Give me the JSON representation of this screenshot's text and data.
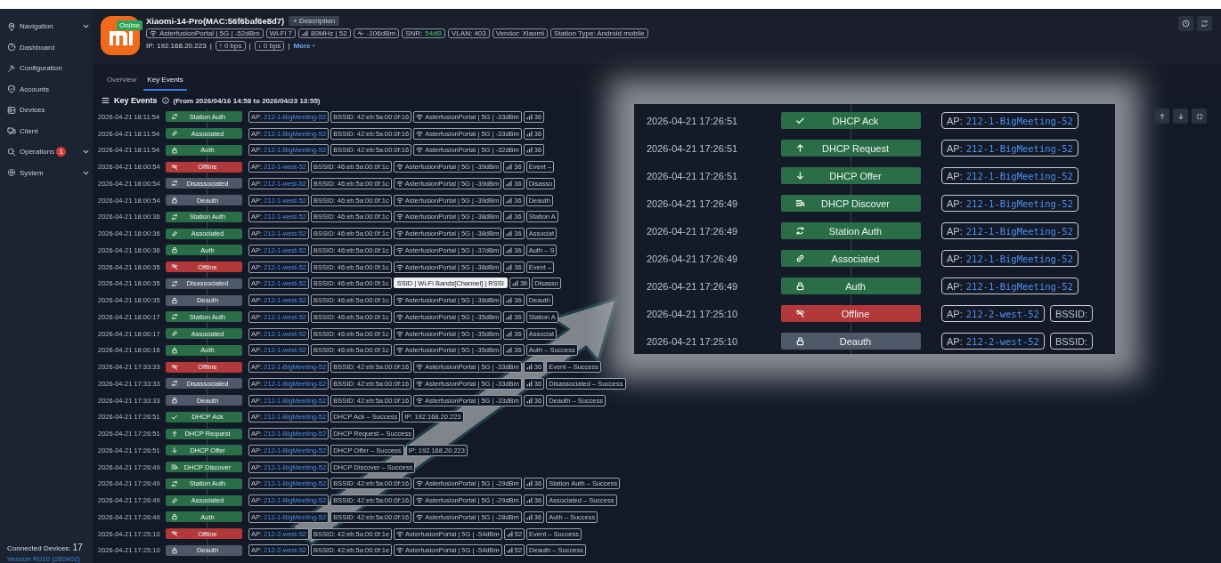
{
  "sidebar": {
    "items": [
      {
        "label": "Navigation",
        "expandable": true
      },
      {
        "label": "Dashboard",
        "expandable": false
      },
      {
        "label": "Configuration",
        "expandable": false
      },
      {
        "label": "Accounts",
        "expandable": false
      },
      {
        "label": "Devices",
        "expandable": false
      },
      {
        "label": "Client",
        "expandable": false
      },
      {
        "label": "Operations",
        "expandable": true,
        "badge": "1"
      },
      {
        "label": "System",
        "expandable": true
      }
    ],
    "connected_label": "Connected Devices:",
    "connected_count": "17",
    "version": "Version R010 (260402)"
  },
  "client": {
    "name": "Xiaomi-14-Pro(MAC:56f6baf6e8d7)",
    "status": "Online",
    "description_button": "+ Description",
    "tags": [
      {
        "kind": "wifi",
        "text": "AsterfusionPortal | 5G | -52dBm"
      },
      {
        "kind": "text",
        "text": "Wi-Fi 7"
      },
      {
        "kind": "bars",
        "text": "80MHz | 52"
      },
      {
        "kind": "noise",
        "text": "-106dBm"
      },
      {
        "kind": "snr",
        "label": "SNR:",
        "value": "54dB"
      },
      {
        "kind": "text",
        "text": "VLAN: 403"
      },
      {
        "kind": "text",
        "text": "Vendor: Xiaomi"
      },
      {
        "kind": "text",
        "text": "Station Type: Android mobile"
      }
    ],
    "ip": "IP: 192.168.20.223",
    "separator": "|",
    "upload": "↑ 0 bps",
    "download": "↓ 0 bps",
    "more": "More ›"
  },
  "tabs": [
    {
      "label": "Overview",
      "selected": false
    },
    {
      "label": "Key Events",
      "selected": true
    }
  ],
  "events": {
    "title": "Key Events",
    "range": "(From 2026/04/16 14:58 to 2026/04/23 13:55)",
    "rows": [
      {
        "time": "2026-04-21 18:11:54",
        "event": {
          "label": "Station Auth",
          "kind": "station-auth"
        },
        "tags": [
          {
            "kind": "ap",
            "label": "AP:",
            "value": "212-1-BigMeeting-52"
          },
          {
            "kind": "text",
            "text": "BSSID: 42:eb:5a:00:0f:16"
          },
          {
            "kind": "ssid",
            "text": "AsterfusionPortal | 5G | -33dBm"
          },
          {
            "kind": "channel",
            "text": "36"
          }
        ]
      },
      {
        "time": "2026-04-21 18:11:54",
        "event": {
          "label": "Associated",
          "kind": "associated"
        },
        "tags": [
          {
            "kind": "ap",
            "label": "AP:",
            "value": "212-1-BigMeeting-52"
          },
          {
            "kind": "text",
            "text": "BSSID: 42:eb:5a:00:0f:16"
          },
          {
            "kind": "ssid",
            "text": "AsterfusionPortal | 5G | -33dBm"
          },
          {
            "kind": "channel",
            "text": "36"
          }
        ]
      },
      {
        "time": "2026-04-21 18:11:54",
        "event": {
          "label": "Auth",
          "kind": "auth"
        },
        "tags": [
          {
            "kind": "ap",
            "label": "AP:",
            "value": "212-1-BigMeeting-52"
          },
          {
            "kind": "text",
            "text": "BSSID: 42:eb:5a:00:0f:16"
          },
          {
            "kind": "ssid",
            "text": "AsterfusionPortal | 5G | -32dBm"
          },
          {
            "kind": "channel",
            "text": "36"
          }
        ]
      },
      {
        "time": "2026-04-21 18:00:54",
        "event": {
          "label": "Offline",
          "kind": "offline"
        },
        "tags": [
          {
            "kind": "ap",
            "label": "AP:",
            "value": "212-1-west-52"
          },
          {
            "kind": "text",
            "text": "BSSID: 46:eb:5a:00:0f:1c"
          },
          {
            "kind": "ssid",
            "text": "AsterfusionPortal | 5G | -39dBm"
          },
          {
            "kind": "channel",
            "text": "36"
          },
          {
            "kind": "text",
            "text": "Event –"
          }
        ]
      },
      {
        "time": "2026-04-21 18:00:54",
        "event": {
          "label": "Disassociated",
          "kind": "disassociated"
        },
        "tags": [
          {
            "kind": "ap",
            "label": "AP:",
            "value": "212-1-west-52"
          },
          {
            "kind": "text",
            "text": "BSSID: 46:eb:5a:00:0f:1c"
          },
          {
            "kind": "ssid",
            "text": "AsterfusionPortal | 5G | -39dBm"
          },
          {
            "kind": "channel",
            "text": "36"
          },
          {
            "kind": "text",
            "text": "Disasso"
          }
        ]
      },
      {
        "time": "2026-04-21 18:00:54",
        "event": {
          "label": "Deauth",
          "kind": "deauth"
        },
        "tags": [
          {
            "kind": "ap",
            "label": "AP:",
            "value": "212-1-west-52"
          },
          {
            "kind": "text",
            "text": "BSSID: 46:eb:5a:00:0f:1c"
          },
          {
            "kind": "ssid",
            "text": "AsterfusionPortal | 5G | -39dBm"
          },
          {
            "kind": "channel",
            "text": "36"
          },
          {
            "kind": "text",
            "text": "Deauth"
          }
        ]
      },
      {
        "time": "2026-04-21 18:00:36",
        "event": {
          "label": "Station Auth",
          "kind": "station-auth"
        },
        "tags": [
          {
            "kind": "ap",
            "label": "AP:",
            "value": "212-1-west-52"
          },
          {
            "kind": "text",
            "text": "BSSID: 46:eb:5a:00:0f:1c"
          },
          {
            "kind": "ssid",
            "text": "AsterfusionPortal | 5G | -38dBm"
          },
          {
            "kind": "channel",
            "text": "36"
          },
          {
            "kind": "text",
            "text": "Station A"
          }
        ]
      },
      {
        "time": "2026-04-21 18:00:36",
        "event": {
          "label": "Associated",
          "kind": "associated"
        },
        "tags": [
          {
            "kind": "ap",
            "label": "AP:",
            "value": "212-1-west-52"
          },
          {
            "kind": "text",
            "text": "BSSID: 46:eb:5a:00:0f:1c"
          },
          {
            "kind": "ssid",
            "text": "AsterfusionPortal | 5G | -38dBm"
          },
          {
            "kind": "channel",
            "text": "36"
          },
          {
            "kind": "text",
            "text": "Associat"
          }
        ]
      },
      {
        "time": "2026-04-21 18:00:36",
        "event": {
          "label": "Auth",
          "kind": "auth"
        },
        "tags": [
          {
            "kind": "ap",
            "label": "AP:",
            "value": "212-1-west-52"
          },
          {
            "kind": "text",
            "text": "BSSID: 46:eb:5a:00:0f:1c"
          },
          {
            "kind": "ssid",
            "text": "AsterfusionPortal | 5G | -37dBm"
          },
          {
            "kind": "channel",
            "text": "36"
          },
          {
            "kind": "text",
            "text": "Auth – S"
          }
        ]
      },
      {
        "time": "2026-04-21 18:00:35",
        "event": {
          "label": "Offline",
          "kind": "offline"
        },
        "tags": [
          {
            "kind": "ap",
            "label": "AP:",
            "value": "212-1-west-52"
          },
          {
            "kind": "text",
            "text": "BSSID: 46:eb:5a:00:0f:1c"
          },
          {
            "kind": "ssid",
            "text": "AsterfusionPortal | 5G | -38dBm"
          },
          {
            "kind": "channel",
            "text": "36"
          },
          {
            "kind": "text",
            "text": "Event –"
          }
        ]
      },
      {
        "time": "2026-04-21 18:00:35",
        "event": {
          "label": "Disassociated",
          "kind": "disassociated"
        },
        "tags": [
          {
            "kind": "ap",
            "label": "AP:",
            "value": "212-1-west-52"
          },
          {
            "kind": "text",
            "text": "BSSID: 46:eb:5a:00:0f:1c"
          },
          {
            "kind": "tooltip",
            "text": "SSID | Wi-Fi Bands[Channel] | RSSI"
          },
          {
            "kind": "channel",
            "text": "36"
          },
          {
            "kind": "text",
            "text": "Disasso"
          }
        ]
      },
      {
        "time": "2026-04-21 18:00:35",
        "event": {
          "label": "Deauth",
          "kind": "deauth"
        },
        "tags": [
          {
            "kind": "ap",
            "label": "AP:",
            "value": "212-1-west-52"
          },
          {
            "kind": "text",
            "text": "BSSID: 46:eb:5a:00:0f:1c"
          },
          {
            "kind": "ssid",
            "text": "AsterfusionPortal | 5G | -38dBm"
          },
          {
            "kind": "channel",
            "text": "36"
          },
          {
            "kind": "text",
            "text": "Deauth"
          }
        ]
      },
      {
        "time": "2026-04-21 18:00:17",
        "event": {
          "label": "Station Auth",
          "kind": "station-auth"
        },
        "tags": [
          {
            "kind": "ap",
            "label": "AP:",
            "value": "212-1-west-52"
          },
          {
            "kind": "text",
            "text": "BSSID: 46:eb:5a:00:0f:1c"
          },
          {
            "kind": "ssid",
            "text": "AsterfusionPortal | 5G | -35dBm"
          },
          {
            "kind": "channel",
            "text": "36"
          },
          {
            "kind": "text",
            "text": "Station A"
          }
        ]
      },
      {
        "time": "2026-04-21 18:00:17",
        "event": {
          "label": "Associated",
          "kind": "associated"
        },
        "tags": [
          {
            "kind": "ap",
            "label": "AP:",
            "value": "212-1-west-52"
          },
          {
            "kind": "text",
            "text": "BSSID: 46:eb:5a:00:0f:1c"
          },
          {
            "kind": "ssid",
            "text": "AsterfusionPortal | 5G | -35dBm"
          },
          {
            "kind": "channel",
            "text": "36"
          },
          {
            "kind": "text",
            "text": "Associat"
          }
        ]
      },
      {
        "time": "2026-04-21 18:00:16",
        "event": {
          "label": "Auth",
          "kind": "auth"
        },
        "tags": [
          {
            "kind": "ap",
            "label": "AP:",
            "value": "212-1-west-52"
          },
          {
            "kind": "text",
            "text": "BSSID: 46:eb:5a:00:0f:1c"
          },
          {
            "kind": "ssid",
            "text": "AsterfusionPortal | 5G | -35dBm"
          },
          {
            "kind": "channel",
            "text": "36"
          },
          {
            "kind": "text",
            "text": "Auth – Success"
          }
        ]
      },
      {
        "time": "2026-04-21 17:33:33",
        "event": {
          "label": "Offline",
          "kind": "offline"
        },
        "tags": [
          {
            "kind": "ap",
            "label": "AP:",
            "value": "212-1-BigMeeting-52"
          },
          {
            "kind": "text",
            "text": "BSSID: 42:eb:5a:00:0f:16"
          },
          {
            "kind": "ssid",
            "text": "AsterfusionPortal | 5G | -33dBm"
          },
          {
            "kind": "channel",
            "text": "36"
          },
          {
            "kind": "text",
            "text": "Event – Success"
          }
        ]
      },
      {
        "time": "2026-04-21 17:33:33",
        "event": {
          "label": "Disassociated",
          "kind": "disassociated"
        },
        "tags": [
          {
            "kind": "ap",
            "label": "AP:",
            "value": "212-1-BigMeeting-52"
          },
          {
            "kind": "text",
            "text": "BSSID: 42:eb:5a:00:0f:16"
          },
          {
            "kind": "ssid",
            "text": "AsterfusionPortal | 5G | -33dBm"
          },
          {
            "kind": "channel",
            "text": "36"
          },
          {
            "kind": "text",
            "text": "Disassociated – Success"
          }
        ]
      },
      {
        "time": "2026-04-21 17:33:33",
        "event": {
          "label": "Deauth",
          "kind": "deauth"
        },
        "tags": [
          {
            "kind": "ap",
            "label": "AP:",
            "value": "212-1-BigMeeting-52"
          },
          {
            "kind": "text",
            "text": "BSSID: 42:eb:5a:00:0f:16"
          },
          {
            "kind": "ssid",
            "text": "AsterfusionPortal | 5G | -33dBm"
          },
          {
            "kind": "channel",
            "text": "36"
          },
          {
            "kind": "text",
            "text": "Deauth – Success"
          }
        ]
      },
      {
        "time": "2026-04-21 17:26:51",
        "event": {
          "label": "DHCP Ack",
          "kind": "dhcp-ack"
        },
        "tags": [
          {
            "kind": "ap",
            "label": "AP:",
            "value": "212-1-BigMeeting-52"
          },
          {
            "kind": "text",
            "text": "DHCP Ack – Success"
          },
          {
            "kind": "text",
            "text": "IP: 192.168.20.223"
          }
        ]
      },
      {
        "time": "2026-04-21 17:26:51",
        "event": {
          "label": "DHCP Request",
          "kind": "dhcp-request"
        },
        "tags": [
          {
            "kind": "ap",
            "label": "AP:",
            "value": "212-1-BigMeeting-52"
          },
          {
            "kind": "text",
            "text": "DHCP Request – Success"
          }
        ]
      },
      {
        "time": "2026-04-21 17:26:51",
        "event": {
          "label": "DHCP Offer",
          "kind": "dhcp-offer"
        },
        "tags": [
          {
            "kind": "ap",
            "label": "AP:",
            "value": "212-1-BigMeeting-52"
          },
          {
            "kind": "text",
            "text": "DHCP Offer – Success"
          },
          {
            "kind": "text",
            "text": "IP: 192.168.20.223"
          }
        ]
      },
      {
        "time": "2026-04-21 17:26:49",
        "event": {
          "label": "DHCP Discover",
          "kind": "dhcp-discover"
        },
        "tags": [
          {
            "kind": "ap",
            "label": "AP:",
            "value": "212-1-BigMeeting-52"
          },
          {
            "kind": "text",
            "text": "DHCP Discover – Success"
          }
        ]
      },
      {
        "time": "2026-04-21 17:26:49",
        "event": {
          "label": "Station Auth",
          "kind": "station-auth"
        },
        "tags": [
          {
            "kind": "ap",
            "label": "AP:",
            "value": "212-1-BigMeeting-52"
          },
          {
            "kind": "text",
            "text": "BSSID: 42:eb:5a:00:0f:16"
          },
          {
            "kind": "ssid",
            "text": "AsterfusionPortal | 5G | -29dBm"
          },
          {
            "kind": "channel",
            "text": "36"
          },
          {
            "kind": "text",
            "text": "Station Auth – Success"
          }
        ]
      },
      {
        "time": "2026-04-21 17:26:49",
        "event": {
          "label": "Associated",
          "kind": "associated"
        },
        "tags": [
          {
            "kind": "ap",
            "label": "AP:",
            "value": "212-1-BigMeeting-52"
          },
          {
            "kind": "text",
            "text": "BSSID: 42:eb:5a:00:0f:16"
          },
          {
            "kind": "ssid",
            "text": "AsterfusionPortal | 5G | -29dBm"
          },
          {
            "kind": "channel",
            "text": "36"
          },
          {
            "kind": "text",
            "text": "Associated – Success"
          }
        ]
      },
      {
        "time": "2026-04-21 17:26:49",
        "event": {
          "label": "Auth",
          "kind": "auth"
        },
        "tags": [
          {
            "kind": "ap",
            "label": "AP:",
            "value": "212-1-BigMeeting-52"
          },
          {
            "kind": "text",
            "text": "BSSID: 42:eb:5a:00:0f:16"
          },
          {
            "kind": "ssid",
            "text": "AsterfusionPortal | 5G | -28dBm"
          },
          {
            "kind": "channel",
            "text": "36"
          },
          {
            "kind": "text",
            "text": "Auth – Success"
          }
        ]
      },
      {
        "time": "2026-04-21 17:25:10",
        "event": {
          "label": "Offline",
          "kind": "offline"
        },
        "tags": [
          {
            "kind": "ap",
            "label": "AP:",
            "value": "212-2-west-52"
          },
          {
            "kind": "text",
            "text": "BSSID: 42:eb:5a:00:0f:1e"
          },
          {
            "kind": "ssid",
            "text": "AsterfusionPortal | 5G | -54dBm"
          },
          {
            "kind": "channel",
            "text": "52"
          },
          {
            "kind": "text",
            "text": "Event – Success"
          }
        ]
      },
      {
        "time": "2026-04-21 17:25:10",
        "event": {
          "label": "Deauth",
          "kind": "deauth"
        },
        "tags": [
          {
            "kind": "ap",
            "label": "AP:",
            "value": "212-2-west-52"
          },
          {
            "kind": "text",
            "text": "BSSID: 42:eb:5a:00:0f:1e"
          },
          {
            "kind": "ssid",
            "text": "AsterfusionPortal | 5G | -54dBm"
          },
          {
            "kind": "channel",
            "text": "52"
          },
          {
            "kind": "text",
            "text": "Deauth – Success"
          }
        ]
      }
    ]
  },
  "zoom_callout": {
    "rows": [
      {
        "time": "2026-04-21 17:26:51",
        "event": {
          "label": "DHCP Ack",
          "kind": "dhcp-ack"
        },
        "tags": [
          {
            "kind": "ap",
            "label": "AP:",
            "value": "212-1-BigMeeting-52"
          }
        ]
      },
      {
        "time": "2026-04-21 17:26:51",
        "event": {
          "label": "DHCP Request",
          "kind": "dhcp-request"
        },
        "tags": [
          {
            "kind": "ap",
            "label": "AP:",
            "value": "212-1-BigMeeting-52"
          }
        ]
      },
      {
        "time": "2026-04-21 17:26:51",
        "event": {
          "label": "DHCP Offer",
          "kind": "dhcp-offer"
        },
        "tags": [
          {
            "kind": "ap",
            "label": "AP:",
            "value": "212-1-BigMeeting-52"
          }
        ]
      },
      {
        "time": "2026-04-21 17:26:49",
        "event": {
          "label": "DHCP Discover",
          "kind": "dhcp-discover"
        },
        "tags": [
          {
            "kind": "ap",
            "label": "AP:",
            "value": "212-1-BigMeeting-52"
          }
        ]
      },
      {
        "time": "2026-04-21 17:26:49",
        "event": {
          "label": "Station Auth",
          "kind": "station-auth"
        },
        "tags": [
          {
            "kind": "ap",
            "label": "AP:",
            "value": "212-1-BigMeeting-52"
          }
        ]
      },
      {
        "time": "2026-04-21 17:26:49",
        "event": {
          "label": "Associated",
          "kind": "associated"
        },
        "tags": [
          {
            "kind": "ap",
            "label": "AP:",
            "value": "212-1-BigMeeting-52"
          }
        ]
      },
      {
        "time": "2026-04-21 17:26:49",
        "event": {
          "label": "Auth",
          "kind": "auth"
        },
        "tags": [
          {
            "kind": "ap",
            "label": "AP:",
            "value": "212-1-BigMeeting-52"
          }
        ]
      },
      {
        "time": "2026-04-21 17:25:10",
        "event": {
          "label": "Offline",
          "kind": "offline"
        },
        "tags": [
          {
            "kind": "ap",
            "label": "AP:",
            "value": "212-2-west-52"
          },
          {
            "kind": "text",
            "text": "BSSID:"
          }
        ]
      },
      {
        "time": "2026-04-21 17:25:10",
        "event": {
          "label": "Deauth",
          "kind": "deauth"
        },
        "tags": [
          {
            "kind": "ap",
            "label": "AP:",
            "value": "212-2-west-52"
          },
          {
            "kind": "text",
            "text": "BSSID:"
          }
        ]
      }
    ]
  }
}
